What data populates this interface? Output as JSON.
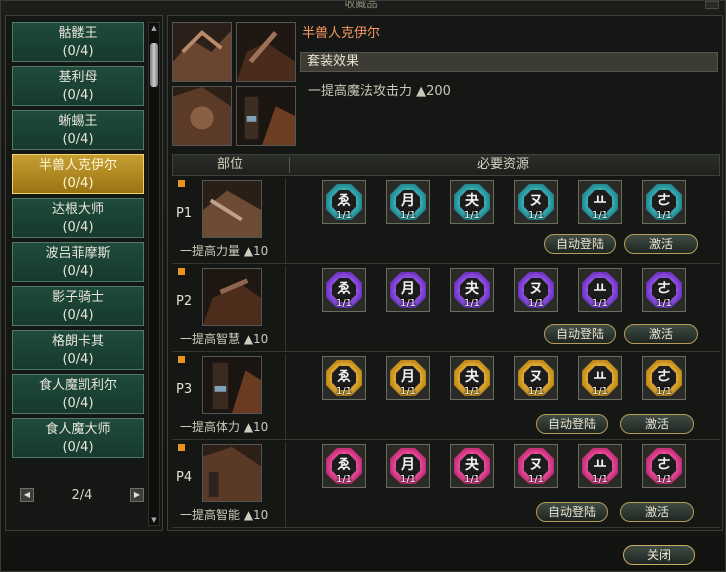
{
  "window": {
    "title": "收藏品"
  },
  "boss_list": {
    "items": [
      {
        "name": "骷髅王",
        "progress": "(0/4)"
      },
      {
        "name": "基利母",
        "progress": "(0/4)"
      },
      {
        "name": "蜥蜴王",
        "progress": "(0/4)"
      },
      {
        "name": "半兽人克伊尔",
        "progress": "(0/4)",
        "selected": true
      },
      {
        "name": "达根大师",
        "progress": "(0/4)"
      },
      {
        "name": "波吕菲摩斯",
        "progress": "(0/4)"
      },
      {
        "name": "影子骑士",
        "progress": "(0/4)"
      },
      {
        "name": "格朗卡其",
        "progress": "(0/4)"
      },
      {
        "name": "食人魔凯利尔",
        "progress": "(0/4)"
      },
      {
        "name": "食人魔大师",
        "progress": "(0/4)"
      }
    ],
    "page": "2/4"
  },
  "set": {
    "title": "半兽人克伊尔",
    "effect_header": "套装效果",
    "effect_text": "一提高魔法攻击力 ▲200"
  },
  "table": {
    "col_part": "部位",
    "col_resources": "必要资源"
  },
  "parts": [
    {
      "label": "P1",
      "stat": "一提高力量 ▲10",
      "color": "teal",
      "runes": [
        {
          "glyph": "ゑ",
          "count": "1/1"
        },
        {
          "glyph": "月",
          "count": "1/1"
        },
        {
          "glyph": "夬",
          "count": "1/1"
        },
        {
          "glyph": "ヌ",
          "count": "1/1"
        },
        {
          "glyph": "ㅛ",
          "count": "1/1"
        },
        {
          "glyph": "ㄜ",
          "count": "1/1"
        }
      ]
    },
    {
      "label": "P2",
      "stat": "一提高智慧 ▲10",
      "color": "purple",
      "runes": [
        {
          "glyph": "ゑ",
          "count": "1/1"
        },
        {
          "glyph": "月",
          "count": "1/1"
        },
        {
          "glyph": "夬",
          "count": "1/1"
        },
        {
          "glyph": "ヌ",
          "count": "1/1"
        },
        {
          "glyph": "ㅛ",
          "count": "1/1"
        },
        {
          "glyph": "ㄜ",
          "count": "1/1"
        }
      ]
    },
    {
      "label": "P3",
      "stat": "一提高体力 ▲10",
      "color": "gold",
      "runes": [
        {
          "glyph": "ゑ",
          "count": "1/1"
        },
        {
          "glyph": "月",
          "count": "1/1"
        },
        {
          "glyph": "夬",
          "count": "1/1"
        },
        {
          "glyph": "ヌ",
          "count": "1/1"
        },
        {
          "glyph": "ㅛ",
          "count": "1/1"
        },
        {
          "glyph": "ㄜ",
          "count": "1/1"
        }
      ]
    },
    {
      "label": "P4",
      "stat": "一提高智能 ▲10",
      "color": "pink",
      "runes": [
        {
          "glyph": "ゑ",
          "count": "1/1"
        },
        {
          "glyph": "月",
          "count": "1/1"
        },
        {
          "glyph": "夬",
          "count": "1/1"
        },
        {
          "glyph": "ヌ",
          "count": "1/1"
        },
        {
          "glyph": "ㅛ",
          "count": "1/1"
        },
        {
          "glyph": "ㄜ",
          "count": "1/1"
        }
      ]
    }
  ],
  "buttons": {
    "register": "自动登陆",
    "activate": "激活",
    "close": "关闭"
  },
  "colors": {
    "list_item": "#1f4a3c",
    "list_selected": "#c69e33",
    "set_title": "#ff9a66"
  }
}
